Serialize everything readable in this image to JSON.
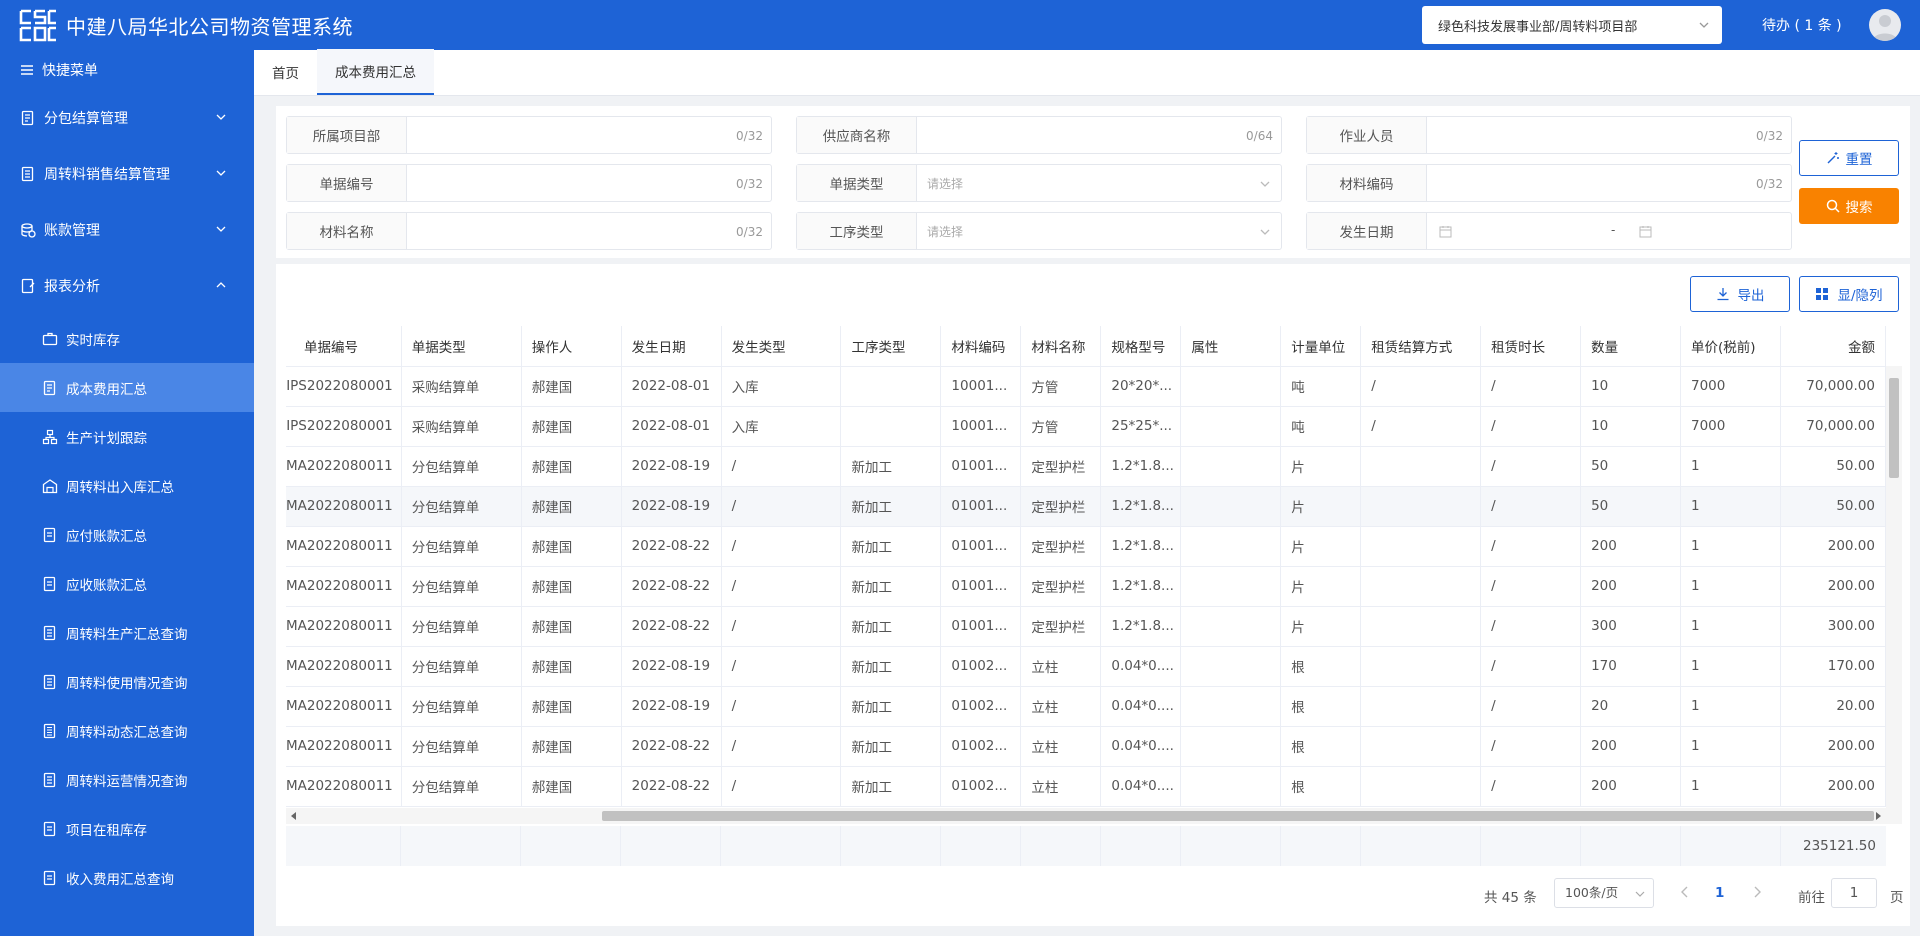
{
  "header": {
    "title": "中建八局华北公司物资管理系统",
    "org_select": "绿色科技发展事业部/周转料项目部",
    "todo": "待办 ( 1 条 )"
  },
  "sidebar": {
    "quick_menu": "快捷菜单",
    "groups": [
      {
        "label": "分包结算管理"
      },
      {
        "label": "周转料销售结算管理"
      },
      {
        "label": "账款管理"
      },
      {
        "label": "报表分析"
      }
    ],
    "sub_items": [
      {
        "label": "实时库存"
      },
      {
        "label": "成本费用汇总"
      },
      {
        "label": "生产计划跟踪"
      },
      {
        "label": "周转料出入库汇总"
      },
      {
        "label": "应付账款汇总"
      },
      {
        "label": "应收账款汇总"
      },
      {
        "label": "周转料生产汇总查询"
      },
      {
        "label": "周转料使用情况查询"
      },
      {
        "label": "周转料动态汇总查询"
      },
      {
        "label": "周转料运营情况查询"
      },
      {
        "label": "项目在租库存"
      },
      {
        "label": "收入费用汇总查询"
      }
    ]
  },
  "tabs": [
    {
      "label": "首页"
    },
    {
      "label": "成本费用汇总"
    }
  ],
  "filters": {
    "project_dept": {
      "label": "所属项目部",
      "count": "0/32"
    },
    "supplier": {
      "label": "供应商名称",
      "count": "0/64"
    },
    "operator": {
      "label": "作业人员",
      "count": "0/32"
    },
    "doc_no": {
      "label": "单据编号",
      "count": "0/32"
    },
    "doc_type": {
      "label": "单据类型",
      "placeholder": "请选择"
    },
    "material_code": {
      "label": "材料编码",
      "count": "0/32"
    },
    "material_name": {
      "label": "材料名称",
      "count": "0/32"
    },
    "process_type": {
      "label": "工序类型",
      "placeholder": "请选择"
    },
    "date": {
      "label": "发生日期",
      "separator": "-"
    }
  },
  "buttons": {
    "reset": "重置",
    "search": "搜索",
    "export": "导出",
    "columns": "显/隐列"
  },
  "table": {
    "headers": [
      "单据编号",
      "单据类型",
      "操作人",
      "发生日期",
      "发生类型",
      "工序类型",
      "材料编码",
      "材料名称",
      "规格型号",
      "属性",
      "计量单位",
      "租赁结算方式",
      "租赁时长",
      "数量",
      "单价(税前)",
      "金额"
    ],
    "rows": [
      [
        "IPS2022080001",
        "采购结算单",
        "郝建国",
        "2022-08-01",
        "入库",
        "",
        "10001...",
        "方管",
        "20*20*...",
        "",
        "吨",
        "/",
        "/",
        "10",
        "7000",
        "70,000.00"
      ],
      [
        "IPS2022080001",
        "采购结算单",
        "郝建国",
        "2022-08-01",
        "入库",
        "",
        "10001...",
        "方管",
        "25*25*...",
        "",
        "吨",
        "/",
        "/",
        "10",
        "7000",
        "70,000.00"
      ],
      [
        "MA2022080011",
        "分包结算单",
        "郝建国",
        "2022-08-19",
        "/",
        "新加工",
        "01001...",
        "定型护栏",
        "1.2*1.8...",
        "",
        "片",
        "",
        "/",
        "50",
        "1",
        "50.00"
      ],
      [
        "MA2022080011",
        "分包结算单",
        "郝建国",
        "2022-08-19",
        "/",
        "新加工",
        "01001...",
        "定型护栏",
        "1.2*1.8...",
        "",
        "片",
        "",
        "/",
        "50",
        "1",
        "50.00"
      ],
      [
        "MA2022080011",
        "分包结算单",
        "郝建国",
        "2022-08-22",
        "/",
        "新加工",
        "01001...",
        "定型护栏",
        "1.2*1.8...",
        "",
        "片",
        "",
        "/",
        "200",
        "1",
        "200.00"
      ],
      [
        "MA2022080011",
        "分包结算单",
        "郝建国",
        "2022-08-22",
        "/",
        "新加工",
        "01001...",
        "定型护栏",
        "1.2*1.8...",
        "",
        "片",
        "",
        "/",
        "200",
        "1",
        "200.00"
      ],
      [
        "MA2022080011",
        "分包结算单",
        "郝建国",
        "2022-08-22",
        "/",
        "新加工",
        "01001...",
        "定型护栏",
        "1.2*1.8...",
        "",
        "片",
        "",
        "/",
        "300",
        "1",
        "300.00"
      ],
      [
        "MA2022080011",
        "分包结算单",
        "郝建国",
        "2022-08-19",
        "/",
        "新加工",
        "01002...",
        "立柱",
        "0.04*0....",
        "",
        "根",
        "",
        "/",
        "170",
        "1",
        "170.00"
      ],
      [
        "MA2022080011",
        "分包结算单",
        "郝建国",
        "2022-08-19",
        "/",
        "新加工",
        "01002...",
        "立柱",
        "0.04*0....",
        "",
        "根",
        "",
        "/",
        "20",
        "1",
        "20.00"
      ],
      [
        "MA2022080011",
        "分包结算单",
        "郝建国",
        "2022-08-22",
        "/",
        "新加工",
        "01002...",
        "立柱",
        "0.04*0....",
        "",
        "根",
        "",
        "/",
        "200",
        "1",
        "200.00"
      ],
      [
        "MA2022080011",
        "分包结算单",
        "郝建国",
        "2022-08-22",
        "/",
        "新加工",
        "01002...",
        "立柱",
        "0.04*0....",
        "",
        "根",
        "",
        "/",
        "200",
        "1",
        "200.00"
      ]
    ],
    "total": "235121.50"
  },
  "pager": {
    "total": "共 45 条",
    "page_size": "100条/页",
    "current_page": "1",
    "goto_label": "前往",
    "goto_value": "1",
    "goto_suffix": "页"
  },
  "colors": {
    "primary": "#1e63d6",
    "active_menu": "#4a86e6",
    "search_button": "#f98200"
  }
}
